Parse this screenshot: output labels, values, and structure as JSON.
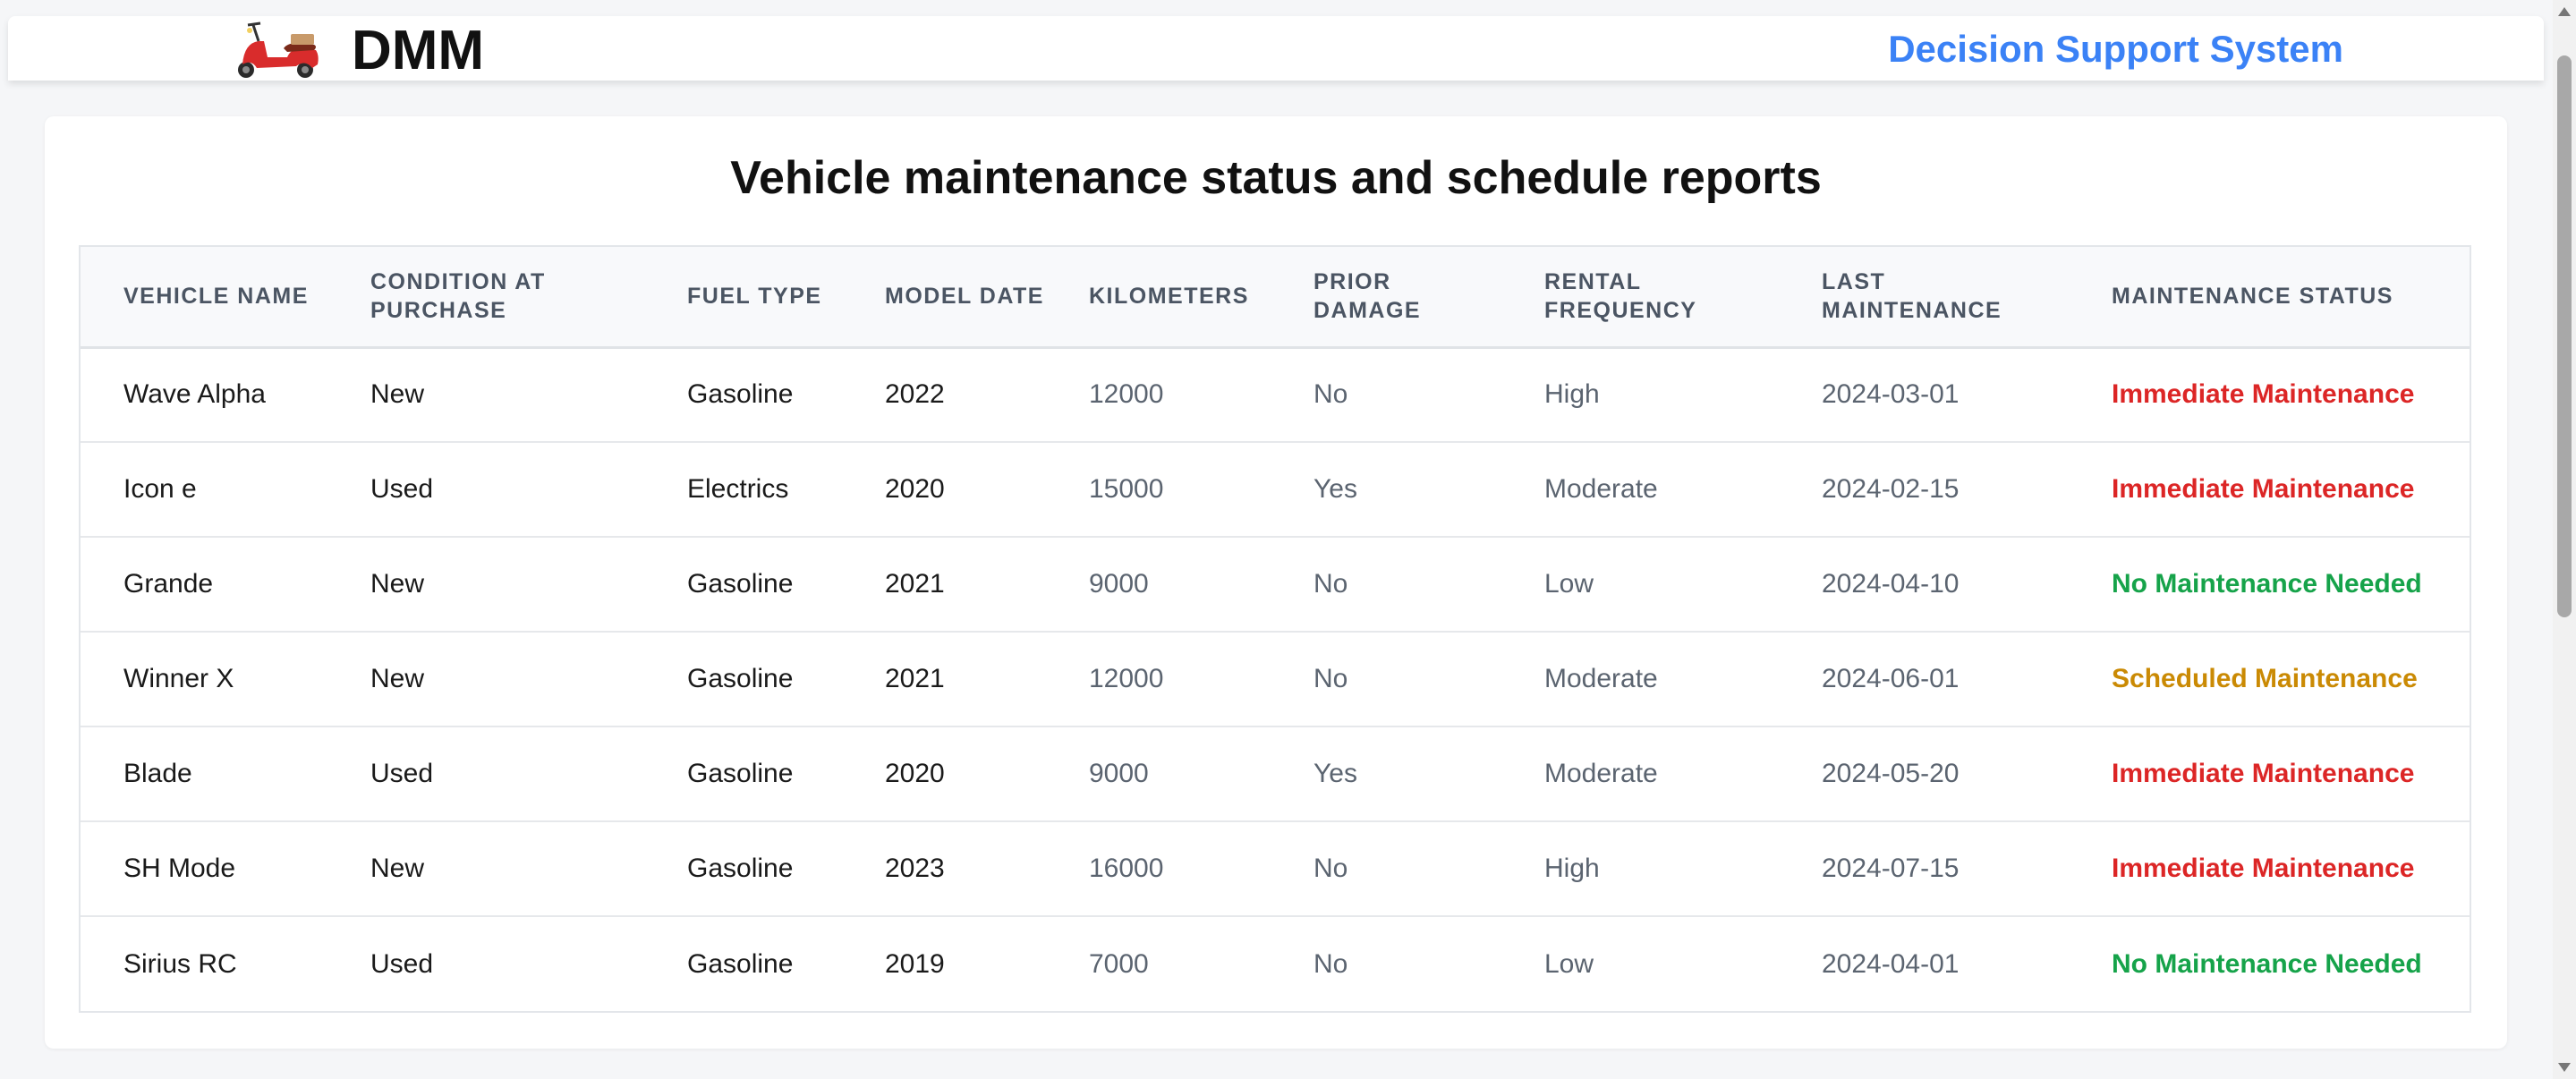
{
  "header": {
    "brand": "DMM",
    "logo_icon": "scooter-icon",
    "title": "Decision Support System",
    "title_color": "#3b82f6"
  },
  "main": {
    "title": "Vehicle maintenance status and schedule reports"
  },
  "table": {
    "columns": [
      "VEHICLE NAME",
      "CONDITION AT PURCHASE",
      "FUEL TYPE",
      "MODEL DATE",
      "KILOMETERS",
      "PRIOR DAMAGE",
      "RENTAL FREQUENCY",
      "LAST MAINTENANCE",
      "MAINTENANCE STATUS"
    ],
    "rows": [
      {
        "name": "Wave Alpha",
        "condition": "New",
        "fuel": "Gasoline",
        "model_date": "2022",
        "km": "12000",
        "damage": "No",
        "frequency": "High",
        "last": "2024-03-01",
        "status": "Immediate Maintenance",
        "status_color": "#dc2626"
      },
      {
        "name": "Icon e",
        "condition": "Used",
        "fuel": "Electrics",
        "model_date": "2020",
        "km": "15000",
        "damage": "Yes",
        "frequency": "Moderate",
        "last": "2024-02-15",
        "status": "Immediate Maintenance",
        "status_color": "#dc2626"
      },
      {
        "name": "Grande",
        "condition": "New",
        "fuel": "Gasoline",
        "model_date": "2021",
        "km": "9000",
        "damage": "No",
        "frequency": "Low",
        "last": "2024-04-10",
        "status": "No Maintenance Needed",
        "status_color": "#16a34a"
      },
      {
        "name": "Winner X",
        "condition": "New",
        "fuel": "Gasoline",
        "model_date": "2021",
        "km": "12000",
        "damage": "No",
        "frequency": "Moderate",
        "last": "2024-06-01",
        "status": "Scheduled Maintenance",
        "status_color": "#ca8a04"
      },
      {
        "name": "Blade",
        "condition": "Used",
        "fuel": "Gasoline",
        "model_date": "2020",
        "km": "9000",
        "damage": "Yes",
        "frequency": "Moderate",
        "last": "2024-05-20",
        "status": "Immediate Maintenance",
        "status_color": "#dc2626"
      },
      {
        "name": "SH Mode",
        "condition": "New",
        "fuel": "Gasoline",
        "model_date": "2023",
        "km": "16000",
        "damage": "No",
        "frequency": "High",
        "last": "2024-07-15",
        "status": "Immediate Maintenance",
        "status_color": "#dc2626"
      },
      {
        "name": "Sirius RC",
        "condition": "Used",
        "fuel": "Gasoline",
        "model_date": "2019",
        "km": "7000",
        "damage": "No",
        "frequency": "Low",
        "last": "2024-04-01",
        "status": "No Maintenance Needed",
        "status_color": "#16a34a"
      }
    ]
  }
}
